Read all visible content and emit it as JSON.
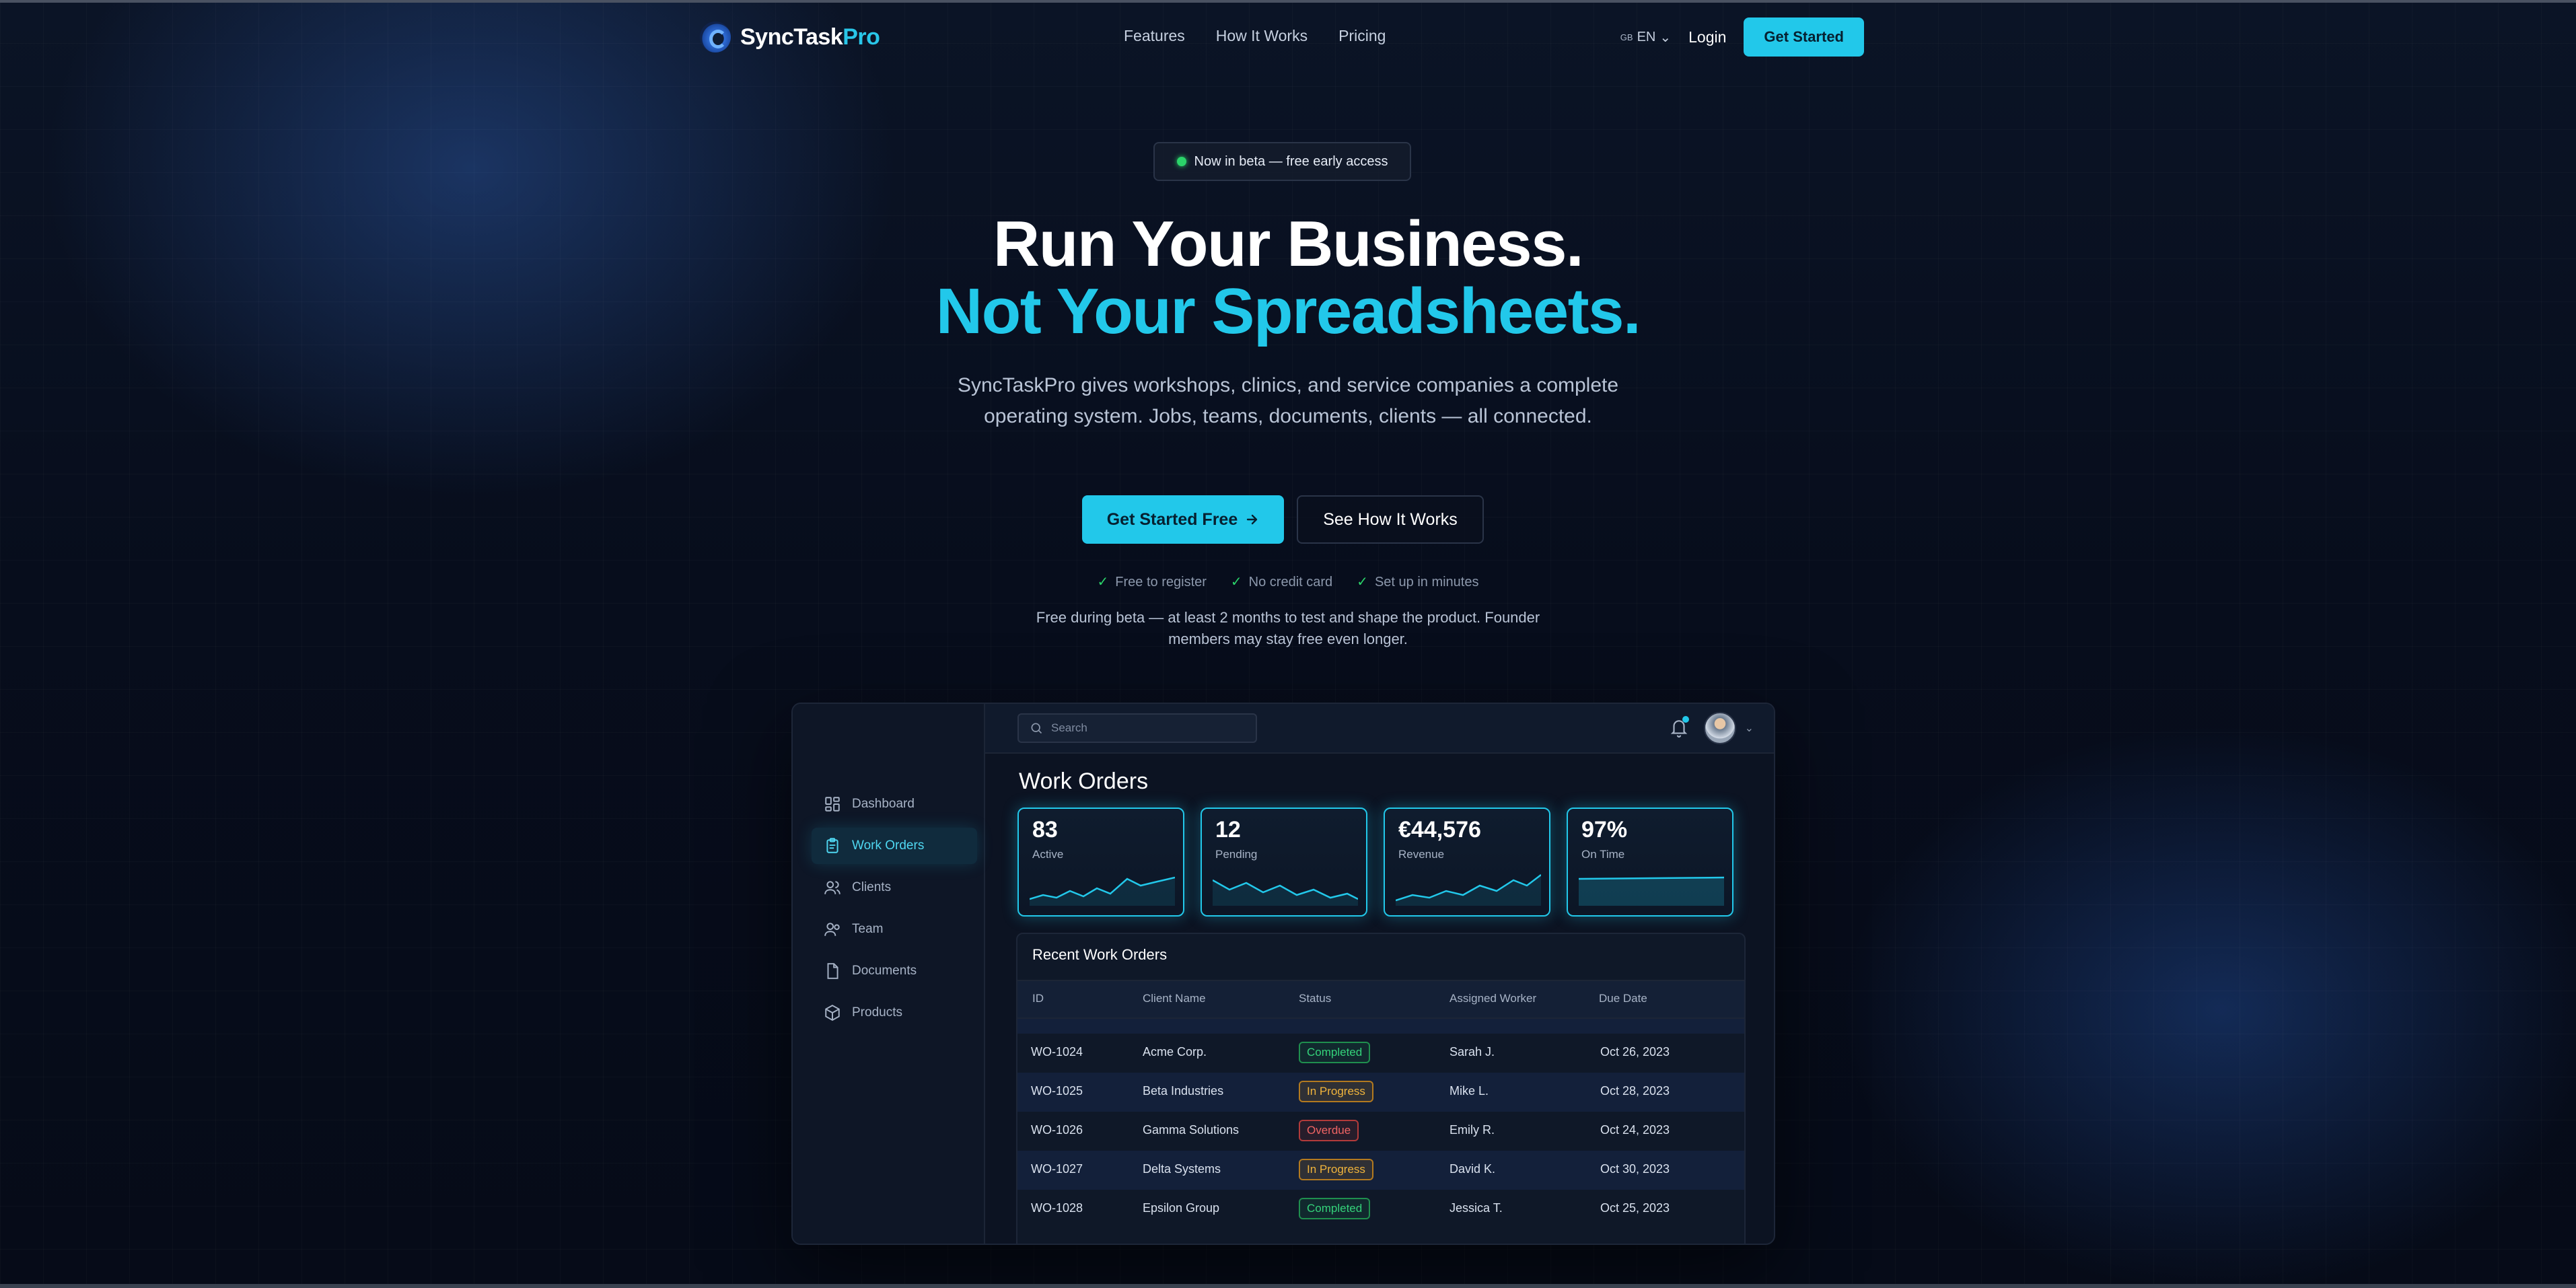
{
  "brand": {
    "name_part1": "SyncTask",
    "name_part2": "Pro"
  },
  "nav": {
    "links": [
      "Features",
      "How It Works",
      "Pricing"
    ],
    "lang_flag": "GB",
    "lang": "EN",
    "login": "Login",
    "get_started": "Get Started"
  },
  "hero": {
    "beta_badge": "Now in beta — free early access",
    "title_line1": "Run Your Business.",
    "title_line2": "Not Your Spreadsheets.",
    "lead": "SyncTaskPro gives workshops, clinics, and service companies a complete operating system. Jobs, teams, documents, clients — all connected.",
    "cta_primary": "Get Started Free",
    "cta_secondary": "See How It Works",
    "checks": [
      "Free to register",
      "No credit card",
      "Set up in minutes"
    ],
    "note": "Free during beta — at least 2 months to test and shape the product. Founder members may stay free even longer."
  },
  "app": {
    "sidebar": [
      "Dashboard",
      "Work Orders",
      "Clients",
      "Team",
      "Documents",
      "Products"
    ],
    "active_sidebar": "Work Orders",
    "search_placeholder": "Search",
    "page_title": "Work Orders",
    "kpis": [
      {
        "value": "83",
        "label": "Active"
      },
      {
        "value": "12",
        "label": "Pending"
      },
      {
        "value": "€44,576",
        "label": "Revenue"
      },
      {
        "value": "97%",
        "label": "On Time"
      }
    ],
    "table": {
      "title": "Recent Work Orders",
      "columns": [
        "ID",
        "Client Name",
        "Status",
        "Assigned Worker",
        "Due Date"
      ],
      "rows": [
        {
          "id": "WO-1024",
          "client": "Acme Corp.",
          "status": "Completed",
          "worker": "Sarah J.",
          "due": "Oct 26, 2023"
        },
        {
          "id": "WO-1025",
          "client": "Beta Industries",
          "status": "In Progress",
          "worker": "Mike L.",
          "due": "Oct 28, 2023"
        },
        {
          "id": "WO-1026",
          "client": "Gamma Solutions",
          "status": "Overdue",
          "worker": "Emily R.",
          "due": "Oct 24, 2023"
        },
        {
          "id": "WO-1027",
          "client": "Delta Systems",
          "status": "In Progress",
          "worker": "David K.",
          "due": "Oct 30, 2023"
        },
        {
          "id": "WO-1028",
          "client": "Epsilon Group",
          "status": "Completed",
          "worker": "Jessica T.",
          "due": "Oct 25, 2023"
        }
      ]
    }
  },
  "colors": {
    "accent": "#22c8ea",
    "background": "#070d1c",
    "success": "#2bd46a",
    "warning": "#f0b43c",
    "danger": "#f06464"
  }
}
